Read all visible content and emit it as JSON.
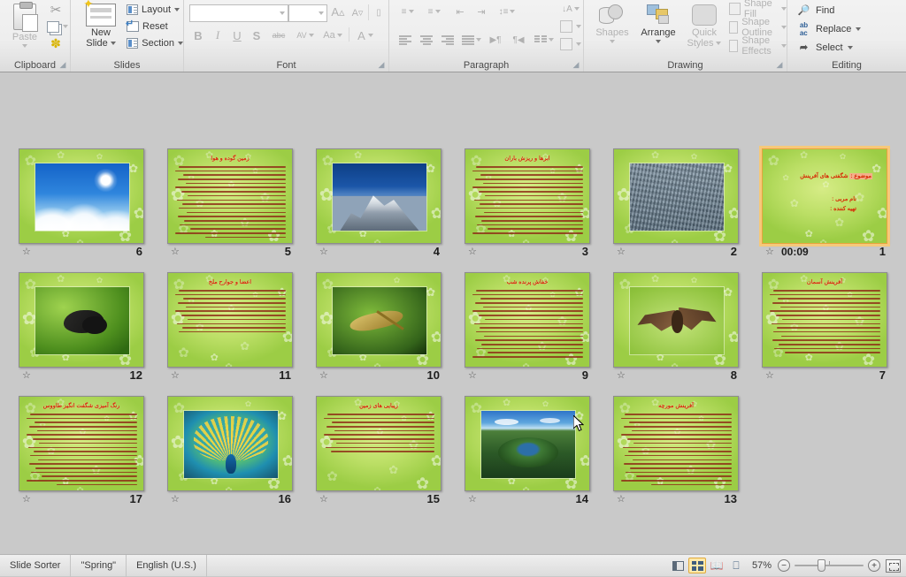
{
  "ribbon": {
    "groups": [
      {
        "name": "clipboard",
        "label": "Clipboard"
      },
      {
        "name": "slides",
        "label": "Slides"
      },
      {
        "name": "font",
        "label": "Font"
      },
      {
        "name": "paragraph",
        "label": "Paragraph"
      },
      {
        "name": "drawing",
        "label": "Drawing"
      },
      {
        "name": "editing",
        "label": "Editing"
      }
    ],
    "clipboard": {
      "paste_label": "Paste",
      "cut_icon": "scissors-icon",
      "copy_icon": "copy-icon",
      "format_painter_icon": "format-painter-icon"
    },
    "slides": {
      "new_slide_label": "New\nSlide",
      "new_slide_line1": "New",
      "new_slide_line2": "Slide",
      "layout_label": "Layout",
      "reset_label": "Reset",
      "section_label": "Section"
    },
    "font": {
      "font_name_value": "",
      "font_name_placeholder": "",
      "font_size_value": "",
      "grow_font_icon": "grow-font-icon",
      "shrink_font_icon": "shrink-font-icon",
      "clear_formatting_icon": "clear-formatting-icon",
      "bold": "B",
      "italic": "I",
      "underline": "U",
      "shadow": "S",
      "strikethrough": "abc",
      "character_spacing": "AV",
      "change_case": "Aa",
      "font_color": "A"
    },
    "paragraph": {
      "bullets_icon": "bullets-icon",
      "numbering_icon": "numbering-icon",
      "decrease_indent_icon": "decrease-indent-icon",
      "increase_indent_icon": "increase-indent-icon",
      "line_spacing_icon": "line-spacing-icon",
      "align_left_icon": "align-left-icon",
      "align_center_icon": "align-center-icon",
      "align_right_icon": "align-right-icon",
      "justify_icon": "justify-icon",
      "ltr_icon": "left-to-right-icon",
      "rtl_icon": "right-to-left-icon",
      "columns_icon": "columns-icon",
      "text_direction_icon": "text-direction-icon",
      "align_text_icon": "align-text-icon",
      "convert_smartart_icon": "convert-to-smartart-icon"
    },
    "drawing": {
      "shapes_label": "Shapes",
      "arrange_label": "Arrange",
      "quick_styles_line1": "Quick",
      "quick_styles_line2": "Styles",
      "shape_fill_label": "Shape Fill",
      "shape_outline_label": "Shape Outline",
      "shape_effects_label": "Shape Effects"
    },
    "editing": {
      "find_label": "Find",
      "replace_label": "Replace",
      "select_label": "Select"
    }
  },
  "status_bar": {
    "view_name": "Slide Sorter",
    "theme_name": "\"Spring\"",
    "language": "English (U.S.)",
    "zoom_percent": "57%",
    "zoom_out_glyph": "−",
    "zoom_in_glyph": "+",
    "views": [
      {
        "name": "normal-view",
        "label": "Normal",
        "active": false
      },
      {
        "name": "slide-sorter-view",
        "label": "Slide Sorter",
        "active": true
      },
      {
        "name": "reading-view",
        "label": "Reading View",
        "active": false
      },
      {
        "name": "slide-show-view",
        "label": "Slide Show",
        "active": false
      }
    ],
    "fit_to_window_label": "Fit slide to current window"
  },
  "slides": [
    {
      "number": "6",
      "kind": "photo",
      "photo": "sky-sun-clouds",
      "title": "",
      "transition": "transition-star-icon",
      "timing": "",
      "selected": false,
      "body_lines": 0
    },
    {
      "number": "5",
      "kind": "text",
      "title": "زمین گوده و هوا",
      "transition": "transition-star-icon",
      "timing": "",
      "selected": false,
      "body_lines": 18
    },
    {
      "number": "4",
      "kind": "photo",
      "photo": "mount-everest",
      "title": "",
      "transition": "transition-star-icon",
      "timing": "",
      "selected": false,
      "body_lines": 0
    },
    {
      "number": "3",
      "kind": "text",
      "title": "ابرها و ریزش باران",
      "transition": "transition-star-icon",
      "timing": "",
      "selected": false,
      "body_lines": 17
    },
    {
      "number": "2",
      "kind": "photo",
      "photo": "ocean-water",
      "title": "",
      "transition": "transition-star-icon",
      "timing": "",
      "selected": false,
      "body_lines": 0
    },
    {
      "number": "1",
      "kind": "title",
      "title": "",
      "transition": "transition-star-icon",
      "timing": "00:09",
      "selected": true,
      "title_slide": {
        "subject_label": "موضوع :",
        "subject_value": "شگفتی های آفرینش",
        "teacher_label": "نام مربی :",
        "author_label": "تهیه کننده :"
      }
    },
    {
      "number": "12",
      "kind": "photo",
      "photo": "ant-on-leaf",
      "title": "",
      "transition": "transition-star-icon",
      "timing": "",
      "selected": false,
      "body_lines": 0
    },
    {
      "number": "11",
      "kind": "text",
      "title": "اعضا و جوارح ملخ",
      "transition": "transition-star-icon",
      "timing": "",
      "selected": false,
      "body_lines": 11
    },
    {
      "number": "10",
      "kind": "photo",
      "photo": "grasshopper",
      "title": "",
      "transition": "transition-star-icon",
      "timing": "",
      "selected": false,
      "body_lines": 0
    },
    {
      "number": "9",
      "kind": "text",
      "title": "خفاش پرنده شب",
      "transition": "transition-star-icon",
      "timing": "",
      "selected": false,
      "body_lines": 17
    },
    {
      "number": "8",
      "kind": "photo",
      "photo": "bat",
      "title": "",
      "transition": "transition-star-icon",
      "timing": "",
      "selected": false,
      "body_lines": 0
    },
    {
      "number": "7",
      "kind": "text",
      "title": "آفرینش آسمان",
      "transition": "transition-star-icon",
      "timing": "",
      "selected": false,
      "body_lines": 16
    },
    {
      "number": "17",
      "kind": "text",
      "title": "رنگ آمیزی شگفت انگیز طاووس",
      "transition": "transition-star-icon",
      "timing": "",
      "selected": false,
      "body_lines": 18
    },
    {
      "number": "16",
      "kind": "photo",
      "photo": "peacock",
      "title": "",
      "transition": "transition-star-icon",
      "timing": "",
      "selected": false,
      "body_lines": 0
    },
    {
      "number": "15",
      "kind": "text",
      "title": "زیبایی های زمین",
      "transition": "transition-star-icon",
      "timing": "",
      "selected": false,
      "body_lines": 10
    },
    {
      "number": "14",
      "kind": "photo",
      "photo": "crater-lake",
      "title": "",
      "transition": "transition-star-icon",
      "timing": "",
      "selected": false,
      "body_lines": 0
    },
    {
      "number": "13",
      "kind": "text",
      "title": "آفرینش مورچه",
      "transition": "transition-star-icon",
      "timing": "",
      "selected": false,
      "body_lines": 18
    }
  ],
  "colors": {
    "workspace_bg": "#c9c9c9",
    "ribbon_bg": "#eeeeee",
    "slide_green": "#b7de6e",
    "slide_title_red": "#d62b06",
    "selection_orange": "#e8a33d",
    "status_bar_bg": "#e4e4e4",
    "active_view_highlight": "#fde9a9"
  }
}
